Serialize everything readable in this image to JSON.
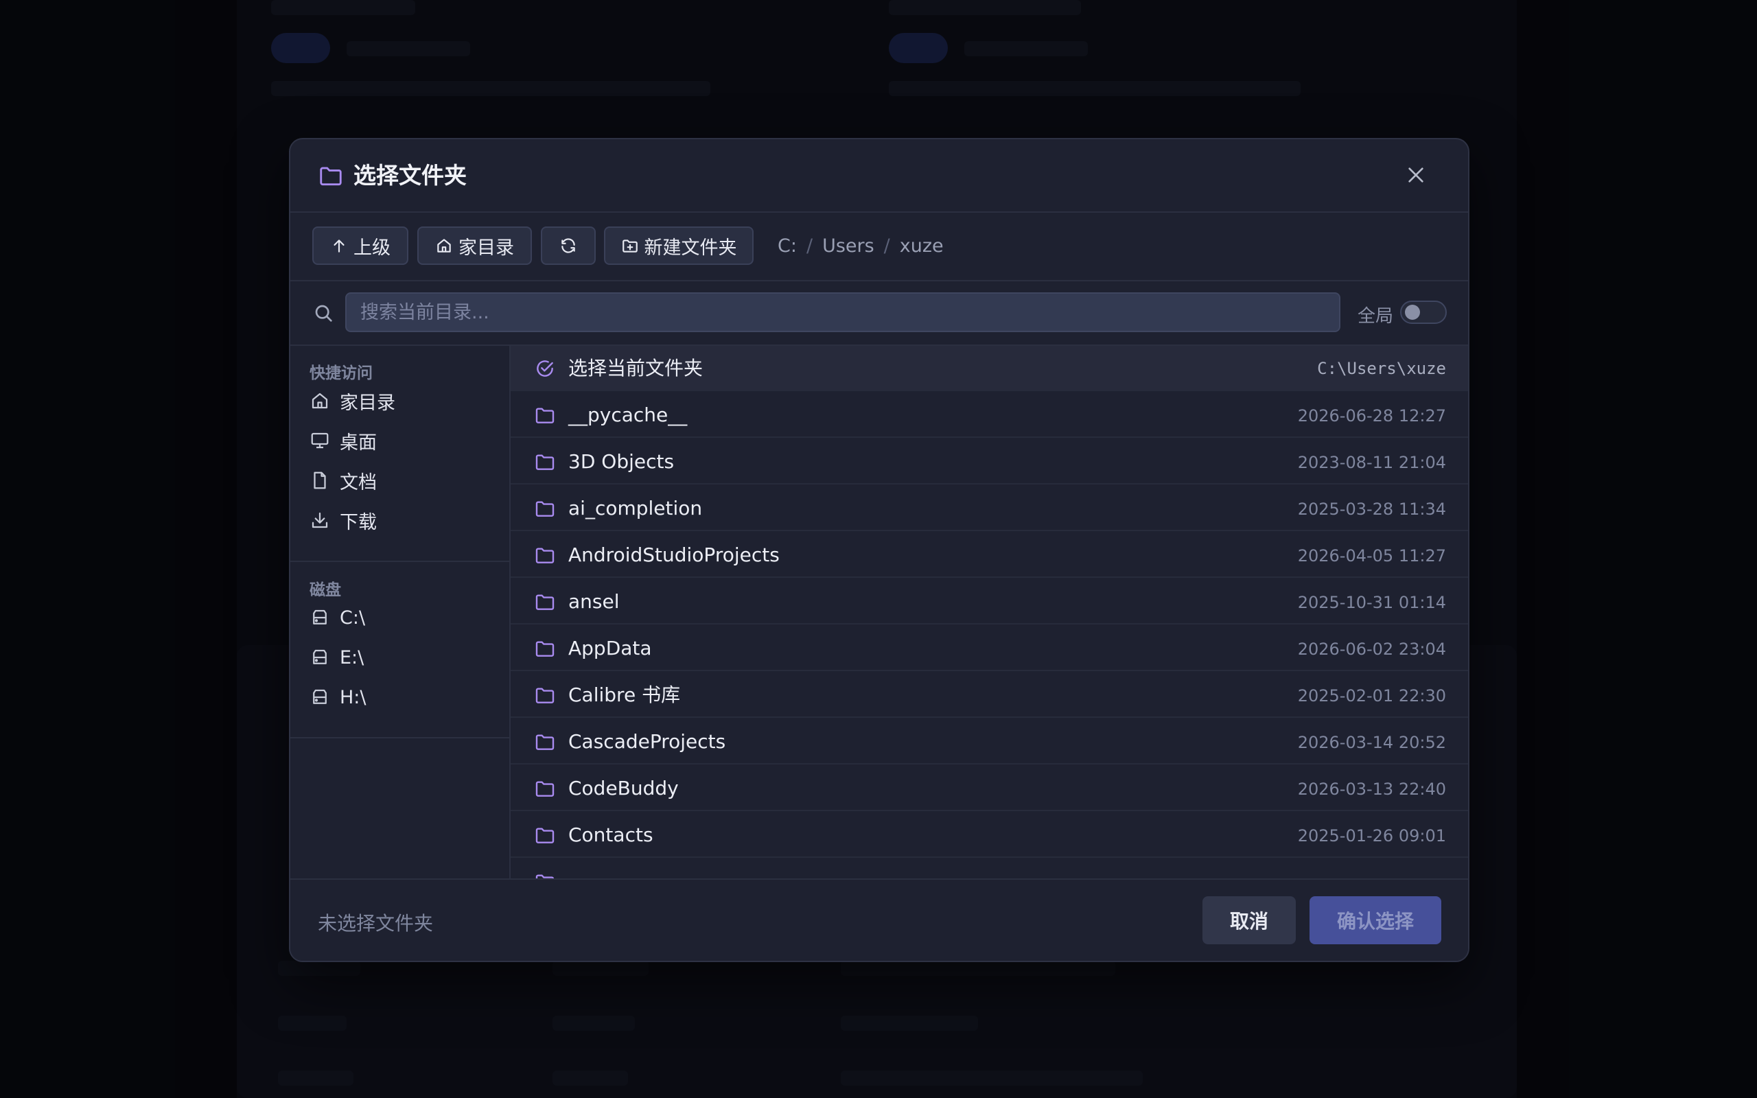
{
  "dialog": {
    "title": "选择文件夹",
    "close_icon": "close-icon"
  },
  "toolbar": {
    "up_label": "上级",
    "home_label": "家目录",
    "new_folder_label": "新建文件夹",
    "breadcrumb": [
      "C:",
      "Users",
      "xuze"
    ],
    "breadcrumb_sep": "/"
  },
  "search": {
    "placeholder": "搜索当前目录...",
    "value": "",
    "global_label": "全局",
    "global_enabled": false
  },
  "sidebar": {
    "quick_title": "快捷访问",
    "quick_items": [
      {
        "label": "家目录",
        "icon": "home-icon"
      },
      {
        "label": "桌面",
        "icon": "monitor-icon"
      },
      {
        "label": "文档",
        "icon": "document-icon"
      },
      {
        "label": "下载",
        "icon": "download-icon"
      }
    ],
    "drives_title": "磁盘",
    "drives": [
      {
        "label": "C:\\",
        "icon": "drive-icon"
      },
      {
        "label": "E:\\",
        "icon": "drive-icon"
      },
      {
        "label": "H:\\",
        "icon": "drive-icon"
      }
    ]
  },
  "current": {
    "label": "选择当前文件夹",
    "path": "C:\\Users\\xuze"
  },
  "folders": [
    {
      "name": "__pycache__",
      "date": "2026-06-28 12:27"
    },
    {
      "name": "3D Objects",
      "date": "2023-08-11 21:04"
    },
    {
      "name": "ai_completion",
      "date": "2025-03-28 11:34"
    },
    {
      "name": "AndroidStudioProjects",
      "date": "2026-04-05 11:27"
    },
    {
      "name": "ansel",
      "date": "2025-10-31 01:14"
    },
    {
      "name": "AppData",
      "date": "2026-06-02 23:04"
    },
    {
      "name": "Calibre 书库",
      "date": "2025-02-01 22:30"
    },
    {
      "name": "CascadeProjects",
      "date": "2026-03-14 20:52"
    },
    {
      "name": "CodeBuddy",
      "date": "2026-03-13 22:40"
    },
    {
      "name": "Contacts",
      "date": "2025-01-26 09:01"
    }
  ],
  "footer": {
    "status": "未选择文件夹",
    "cancel_label": "取消",
    "confirm_label": "确认选择"
  },
  "colors": {
    "accent": "#a98bf0",
    "dialog_bg": "#1e2130",
    "confirm_bg": "#46509a"
  }
}
